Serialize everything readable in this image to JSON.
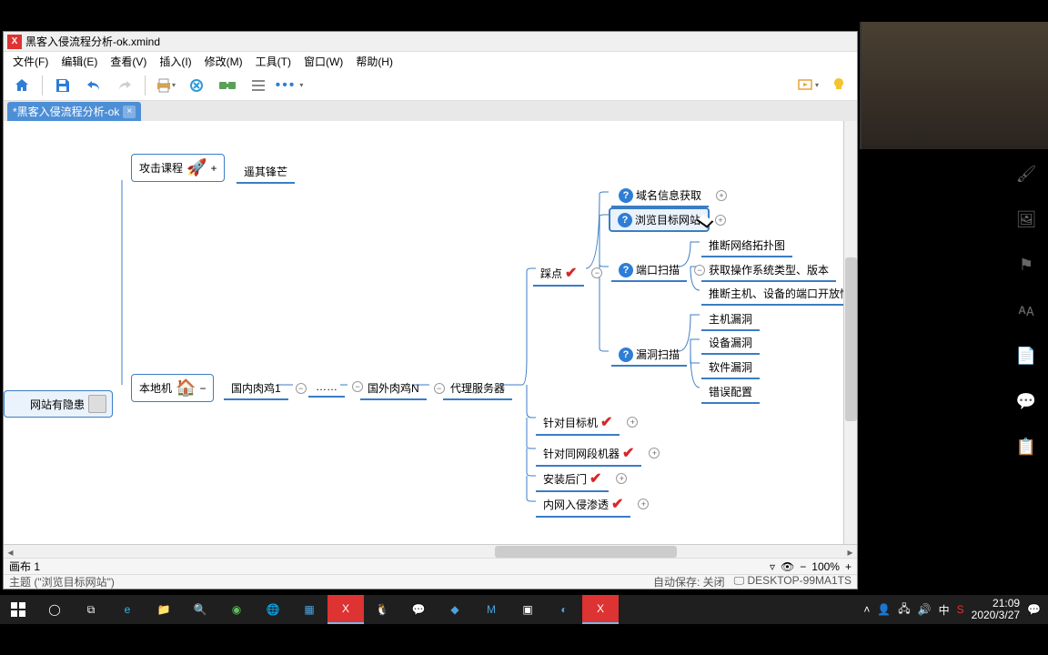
{
  "title": "黑客入侵流程分析-ok.xmind",
  "menu": [
    "文件(F)",
    "编辑(E)",
    "查看(V)",
    "插入(I)",
    "修改(M)",
    "工具(T)",
    "窗口(W)",
    "帮助(H)"
  ],
  "tab": {
    "label": "*黑客入侵流程分析-ok"
  },
  "canvas": {
    "leftNode": "网站有隐患",
    "branch1": {
      "label": "攻击课程",
      "child": "遥其锋芒"
    },
    "branch2": {
      "label": "本地机",
      "chain": [
        "国内肉鸡1",
        "……",
        "国外肉鸡N",
        "代理服务器"
      ],
      "stepA": {
        "label": "踩点",
        "children": [
          {
            "label": "域名信息获取",
            "q": true
          },
          {
            "label": "浏览目标网站",
            "q": true,
            "selected": true
          },
          {
            "label": "端口扫描",
            "q": true,
            "sub": [
              "推断网络拓扑图",
              "获取操作系统类型、版本",
              "推断主机、设备的端口开放情况"
            ]
          },
          {
            "label": "漏洞扫描",
            "q": true,
            "sub": [
              "主机漏洞",
              "设备漏洞",
              "软件漏洞",
              "错误配置"
            ]
          }
        ]
      },
      "stepsBelow": [
        "针对目标机",
        "针对同网段机器",
        "安装后门",
        "内网入侵渗透"
      ]
    }
  },
  "status": {
    "sheet": "画布 1",
    "selection": "主题 (\"浏览目标网站\")",
    "zoom": "100%",
    "autosave": "自动保存: 关闭",
    "host": "DESKTOP-99MA1TS"
  },
  "tray": {
    "time": "21:09",
    "date": "2020/3/27"
  }
}
